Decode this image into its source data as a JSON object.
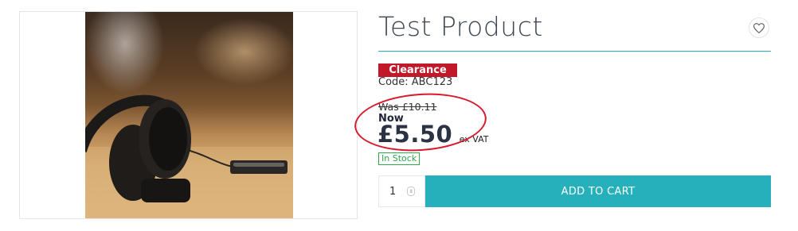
{
  "product": {
    "title": "Test Product",
    "badge": "Clearance",
    "code": "Code: ABC123",
    "was_price": "Was £10.11",
    "now_label": "Now",
    "price": "£5.50",
    "vat_note": "ex VAT",
    "stock_status": "In Stock",
    "quantity": "1"
  },
  "actions": {
    "add_to_cart": "ADD TO CART",
    "wishlist_icon": "heart-icon"
  },
  "colors": {
    "accent": "#25b0bb",
    "badge": "#c0192a",
    "annotation": "#d8192d",
    "in_stock": "#2fa84f",
    "price": "#2a3244"
  }
}
